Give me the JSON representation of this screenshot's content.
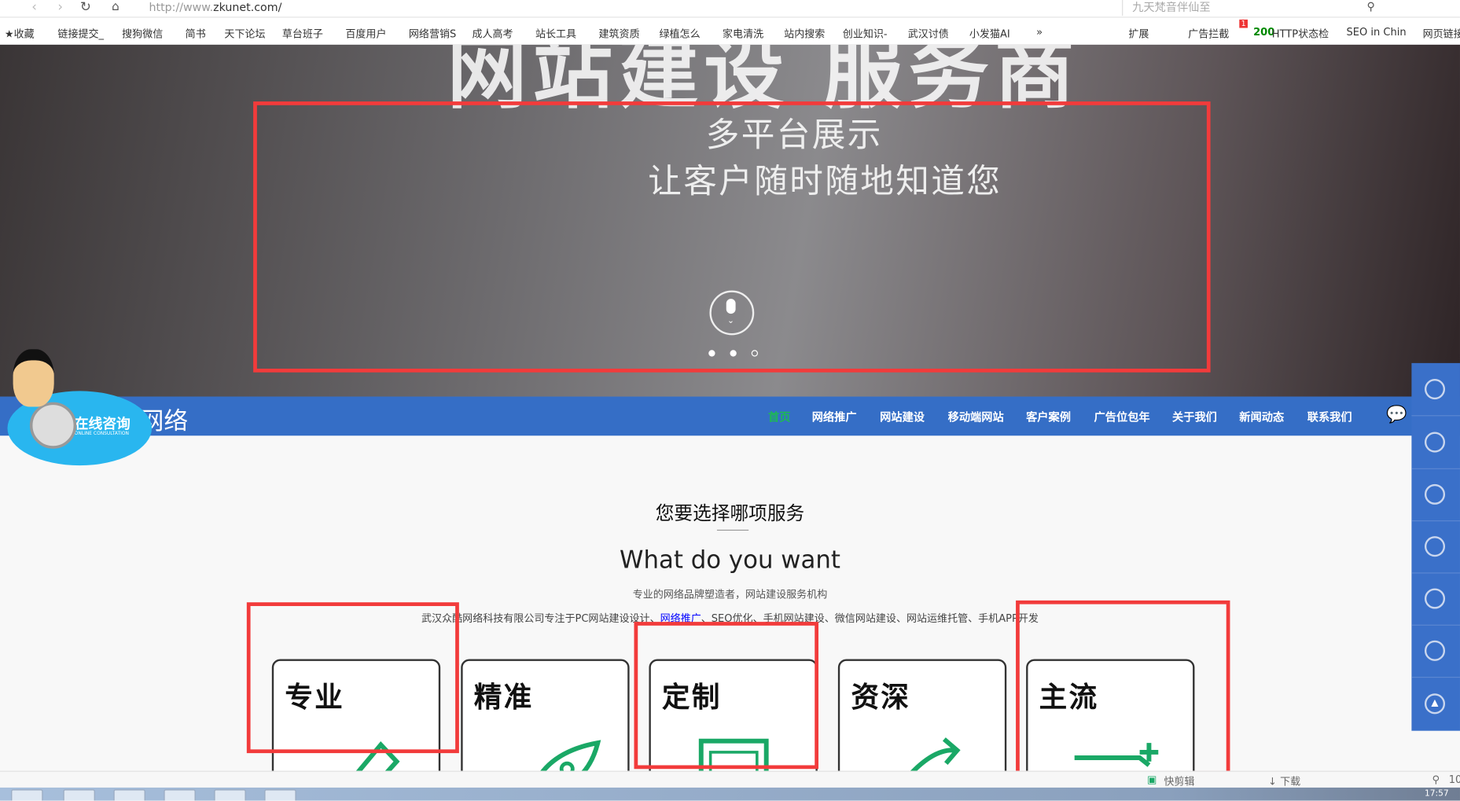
{
  "browser": {
    "url_prefix": "http://www.",
    "url_domain": "zkunet.com/",
    "search_placeholder": "九天梵音伴仙至",
    "bookmarks": [
      "收藏",
      "链接提交_",
      "搜狗微信",
      "简书",
      "天下论坛",
      "草台班子",
      "百度用户",
      "网络营销S",
      "成人高考",
      "站长工具",
      "建筑资质",
      "绿植怎么",
      "家电清洗",
      "站内搜索",
      "创业知识-",
      "武汉讨债",
      "小发猫AI",
      "»",
      "扩展",
      "广告拦截",
      "200",
      "HTTP状态检",
      "SEO in Chin",
      "网页链接"
    ],
    "adblock_badge": "1"
  },
  "hero": {
    "big_title": "网站建设 服务商",
    "line1": "多平台展示",
    "line2": "让客户随时随地知道您",
    "slides": 3,
    "active_slide": 1
  },
  "nav": {
    "logo": "网络",
    "items": [
      "首页",
      "网络推广",
      "网站建设",
      "移动端网站",
      "客户案例",
      "广告位包年",
      "关于我们",
      "新闻动态",
      "联系我们"
    ],
    "active_color": "#1db954",
    "bg": "#356ec6"
  },
  "consult": {
    "title": "在线咨询",
    "subtitle": "ONLINE CONSULTATION"
  },
  "services": {
    "title": "您要选择哪项服务",
    "en_title": "What do you want",
    "subtitle": "专业的网络品牌塑造者，网站建设服务机构",
    "desc_before": "武汉众酷网络科技有限公司专注于PC网站建设设计、",
    "desc_link": "网络推广",
    "desc_after": "、SEO优化、手机网站建设、微信网站建设、网站运维托管、手机APP开发",
    "cards": [
      "专业",
      "精准",
      "定制",
      "资深",
      "主流"
    ]
  },
  "status": {
    "items": [
      "快剪辑",
      "下载"
    ],
    "zoom": "10"
  },
  "taskbar": {
    "time": "17:57"
  },
  "annotation_color": "#f23b3b"
}
